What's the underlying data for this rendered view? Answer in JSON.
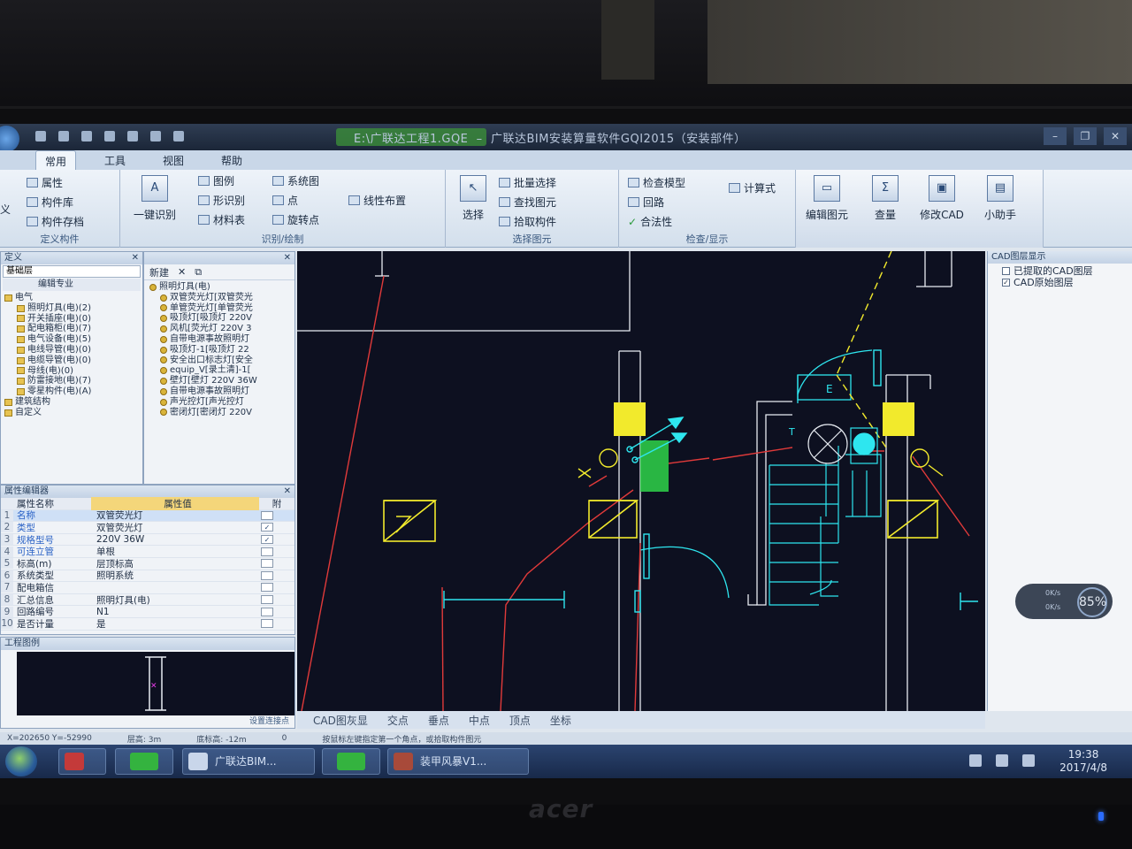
{
  "window": {
    "title_file": "E:\\广联达工程1.GQE",
    "title_app": "广联达BIM安装算量软件GQI2015（安装部件）"
  },
  "ribbon_tabs": [
    "常用",
    "工具",
    "视图",
    "帮助"
  ],
  "ribbon": {
    "define": {
      "label": "定义构件",
      "items": [
        "属性",
        "构件库",
        "构件存档"
      ],
      "left_cut": "义"
    },
    "identify": {
      "label": "识别/绘制",
      "big": "一键识别",
      "items": [
        "图例",
        "形识别",
        "材料表",
        "系统图",
        "点",
        "旋转点",
        "线性布置"
      ]
    },
    "select": {
      "label": "选择图元",
      "big": "选择",
      "items": [
        "批量选择",
        "查找图元",
        "拾取构件"
      ]
    },
    "check": {
      "label": "检查/显示",
      "items": [
        "检查模型",
        "回路",
        "合法性",
        "计算式"
      ]
    },
    "tools": [
      {
        "label": "编辑图元",
        "icon": "edit-icon"
      },
      {
        "label": "查量",
        "icon": "sigma-icon",
        "glyph": "Σ"
      },
      {
        "label": "修改CAD",
        "icon": "cad-edit-icon"
      },
      {
        "label": "小助手",
        "icon": "helper-icon"
      }
    ]
  },
  "left_panel": {
    "header": "定义",
    "combo": "基础层",
    "toolbar_label": "编辑专业",
    "tree": [
      {
        "label": "电气",
        "level": 0
      },
      {
        "label": "照明灯具(电)(2)",
        "level": 1
      },
      {
        "label": "开关插座(电)(0)",
        "level": 1
      },
      {
        "label": "配电箱柜(电)(7)",
        "level": 1
      },
      {
        "label": "电气设备(电)(5)",
        "level": 1
      },
      {
        "label": "电线导管(电)(0)",
        "level": 1
      },
      {
        "label": "电缆导管(电)(0)",
        "level": 1
      },
      {
        "label": "母线(电)(0)",
        "level": 1
      },
      {
        "label": "防雷接地(电)(7)",
        "level": 1
      },
      {
        "label": "零星构件(电)(A)",
        "level": 1
      },
      {
        "label": "建筑结构",
        "level": 0
      },
      {
        "label": "自定义",
        "level": 0
      }
    ]
  },
  "component_list": {
    "new_label": "新建",
    "root": "照明灯具(电)",
    "items": [
      "双管荧光灯[双管荧光",
      "单管荧光灯[单管荧光",
      "吸顶灯[吸顶灯 220V",
      "风机[荧光灯 220V 3",
      "自带电源事故照明灯",
      "吸顶灯-1[吸顶灯 22",
      "安全出口标志灯[安全",
      "equip_V[录土清]-1[",
      "壁灯[壁灯 220V 36W",
      "自带电源事故照明灯",
      "声光控灯[声光控灯",
      "密闭灯[密闭灯 220V"
    ]
  },
  "property_editor": {
    "header": "属性编辑器",
    "col_name": "属性名称",
    "col_value": "属性值",
    "col_attach": "附",
    "rows": [
      {
        "num": "1",
        "name": "名称",
        "value": "双管荧光灯",
        "blue": true,
        "check": ""
      },
      {
        "num": "2",
        "name": "类型",
        "value": "双管荧光灯",
        "blue": true,
        "check": "✓"
      },
      {
        "num": "3",
        "name": "规格型号",
        "value": "220V 36W",
        "blue": true,
        "check": "✓"
      },
      {
        "num": "4",
        "name": "可连立管",
        "value": "单根",
        "blue": true,
        "check": ""
      },
      {
        "num": "5",
        "name": "标高(m)",
        "value": "层顶标高",
        "blue": false,
        "check": ""
      },
      {
        "num": "6",
        "name": "系统类型",
        "value": "照明系统",
        "blue": false,
        "check": ""
      },
      {
        "num": "7",
        "name": "配电箱信",
        "value": "",
        "blue": false,
        "check": ""
      },
      {
        "num": "8",
        "name": "汇总信息",
        "value": "照明灯具(电)",
        "blue": false,
        "check": ""
      },
      {
        "num": "9",
        "name": "回路编号",
        "value": "N1",
        "blue": false,
        "check": ""
      },
      {
        "num": "10",
        "name": "是否计量",
        "value": "是",
        "blue": false,
        "check": ""
      }
    ]
  },
  "legend_panel": {
    "header": "工程图例",
    "footer": "设置连接点"
  },
  "canvas_status": [
    "CAD图灰显",
    "交点",
    "垂点",
    "中点",
    "顶点",
    "坐标"
  ],
  "cad_layers": {
    "header": "CAD图层显示",
    "items": [
      {
        "label": "已提取的CAD图层",
        "checked": false
      },
      {
        "label": "CAD原始图层",
        "checked": true
      }
    ]
  },
  "status_bar": {
    "coords": "X=202650 Y=-52990",
    "floor_height": "层高: 3m",
    "base_elev": "底标高: -12m",
    "zero": "0",
    "hint": "按鼠标左键指定第一个角点，或拾取构件图元"
  },
  "taskbar": {
    "buttons": [
      "广联达BIM...",
      "装甲风暴V1..."
    ],
    "time": "19:38",
    "date": "2017/4/8"
  },
  "network": {
    "percent": "85%",
    "up": "0K/s",
    "down": "0K/s"
  },
  "bezel_brand": "acer",
  "colors": {
    "canvas_bg": "#0d1020",
    "cad_white": "#e8ecf2",
    "cad_red": "#e03a3a",
    "cad_yellow": "#f2ea2c",
    "cad_cyan": "#2ee6ef",
    "cad_green": "#2fd44a",
    "ribbon_bg": "#dfe9f5",
    "title_bg": "#1f2b3f"
  }
}
